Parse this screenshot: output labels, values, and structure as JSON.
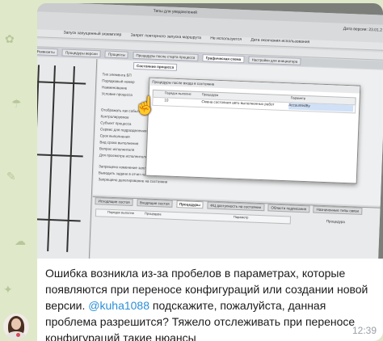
{
  "screenshot_app": {
    "title_bar_label": "Типы для уведомлений",
    "date_version_label": "Дата версии: 23.01.2",
    "options_row": [
      "Запуск запущенный экземпляр",
      "Запрет повторного запуска маршрута",
      "Не используется",
      "Дата окончания использования"
    ],
    "tabs": [
      "Реквизиты",
      "Процедуры версии",
      "Процессы",
      "Процедуры после старта процесса",
      "Графическая схема",
      "Настройки для инициатора"
    ],
    "active_tab": "Графическая схема",
    "state_tab": "Состояние процесса",
    "form_fields": [
      "Тип элемента БП",
      "Порядковый номер",
      "Наименование",
      "Условие процесса",
      "Отображать как событие",
      "Контролируемое",
      "Субъект процесса",
      "Сервис для подразделения",
      "Срок выполнения",
      "Вид срока выполнения",
      "Вопрос исполнителя",
      "Для просмотра исполнителем",
      "Запрещено изменение запланированной субъекта на состоянии",
      "Выводить задачи в отчет по согласованию",
      "Запрещено делегирование на состоянии"
    ],
    "dialog": {
      "title": "Процедуры после входа в состояние",
      "columns": [
        "Порядок выполне",
        "Процедура",
        "Параметр"
      ],
      "row": {
        "order": "10",
        "procedure": "Смена состояния авто выполненных работ",
        "parameter": "AccountedBy"
      }
    },
    "lower_tabs": [
      "Исходящие состоя",
      "Входящие состоя",
      "Процедуры",
      "ФЦ доступность на состоянии",
      "Области подписания",
      "Назначенные типы связи"
    ],
    "lower_active_tab": "Процедуры",
    "lower_columns": [
      "Порядок выполне",
      "Процедура",
      "Параметр"
    ],
    "lower_right_label": "Процедура"
  },
  "message": {
    "text_part1": "Ошибка возникла из-за пробелов в параметрах, которые появляются при переносе конфигураций или создании новой версии.",
    "mention": "@kuha1088",
    "text_part2": "подскажите, пожалуйста, данная проблема разрешится? Тяжело отслеживать при переносе конфигураций такие нюансы",
    "time": "12:39"
  },
  "icons": [
    "hand-cursor-icon",
    "avatar"
  ],
  "colors": {
    "chat_background": "#dfe8c9",
    "bubble": "#ffffff",
    "mention": "#2a8fd8",
    "time": "#9aa0a6"
  }
}
